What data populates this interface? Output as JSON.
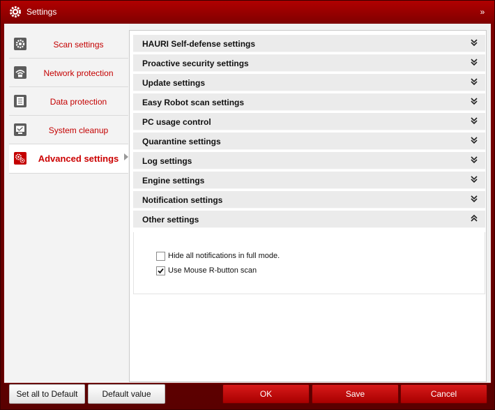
{
  "window": {
    "title": "Settings",
    "collapse_glyph": "»"
  },
  "sidebar": {
    "items": [
      {
        "label": "Scan settings",
        "icon": "gear-icon"
      },
      {
        "label": "Network protection",
        "icon": "network-icon"
      },
      {
        "label": "Data protection",
        "icon": "document-icon"
      },
      {
        "label": "System cleanup",
        "icon": "monitor-icon"
      },
      {
        "label": "Advanced settings",
        "icon": "gears-icon",
        "active": true
      }
    ]
  },
  "sections": [
    {
      "label": "HAURI Self-defense settings",
      "expanded": false
    },
    {
      "label": "Proactive security settings",
      "expanded": false
    },
    {
      "label": "Update settings",
      "expanded": false
    },
    {
      "label": "Easy Robot scan settings",
      "expanded": false
    },
    {
      "label": "PC usage control",
      "expanded": false
    },
    {
      "label": "Quarantine settings",
      "expanded": false
    },
    {
      "label": "Log settings",
      "expanded": false
    },
    {
      "label": "Engine settings",
      "expanded": false
    },
    {
      "label": "Notification settings",
      "expanded": false
    },
    {
      "label": "Other settings",
      "expanded": true
    }
  ],
  "other_settings": {
    "options": [
      {
        "label": "Hide all notifications in full mode.",
        "checked": false
      },
      {
        "label": "Use Mouse R-button scan",
        "checked": true
      }
    ]
  },
  "buttons": {
    "set_all_default": "Set all to Default",
    "default_value": "Default value",
    "ok": "OK",
    "save": "Save",
    "cancel": "Cancel"
  },
  "colors": {
    "accent": "#c40000",
    "title_bar": "#b10000"
  }
}
